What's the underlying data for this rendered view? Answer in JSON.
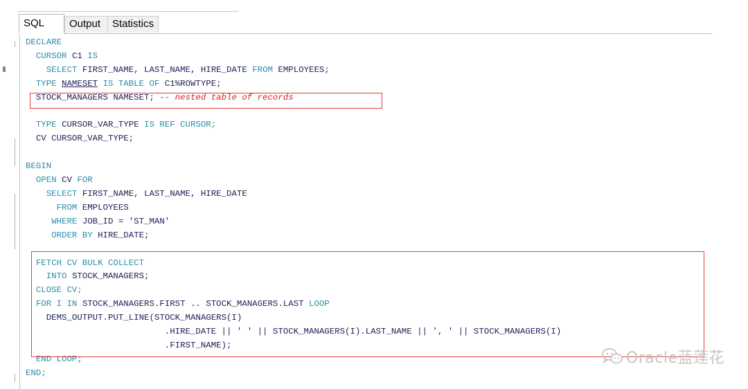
{
  "tabs": [
    {
      "label": "SQL",
      "active": true
    },
    {
      "label": "Output",
      "active": false
    },
    {
      "label": "Statistics",
      "active": false
    }
  ],
  "code": {
    "l1_declare": "DECLARE",
    "l2_cursor": "CURSOR",
    "l2_c1": "C1",
    "l2_is": "IS",
    "l3_select": "SELECT",
    "l3_cols": "FIRST_NAME, LAST_NAME, HIRE_DATE",
    "l3_from": "FROM",
    "l3_table": "EMPLOYEES;",
    "l4_type": "TYPE",
    "l4_nameset": "NAMESET",
    "l4_rest": "IS TABLE OF",
    "l4_c1": "C1%ROWTYPE;",
    "l5_decl": "STOCK_MANAGERS NAMESET;",
    "l5_comment": "-- nested table of records",
    "l7_type": "TYPE",
    "l7_name": "CURSOR_VAR_TYPE",
    "l7_rest": "IS REF CURSOR;",
    "l8_decl": "CV CURSOR_VAR_TYPE;",
    "l10_begin": "BEGIN",
    "l11_open": "OPEN",
    "l11_cv": "CV",
    "l11_for": "FOR",
    "l12_select": "SELECT",
    "l12_cols": "FIRST_NAME, LAST_NAME, HIRE_DATE",
    "l13_from": "FROM",
    "l13_table": "EMPLOYEES",
    "l14_where": "WHERE",
    "l14_cond": "JOB_ID = 'ST_MAN'",
    "l15_order": "ORDER BY",
    "l15_col": "HIRE_DATE;",
    "l17_fetch": "FETCH CV BULK COLLECT",
    "l18_into": "INTO",
    "l18_target": "STOCK_MANAGERS;",
    "l19_close": "CLOSE CV;",
    "l20_for": "FOR I IN",
    "l20_range": "STOCK_MANAGERS.FIRST .. STOCK_MANAGERS.LAST",
    "l20_loop": "LOOP",
    "l21_put": "DEMS_OUTPUT.PUT_LINE(STOCK_MANAGERS(I)",
    "l22_cont": ".HIRE_DATE || ' ' || STOCK_MANAGERS(I).LAST_NAME || ', ' || STOCK_MANAGERS(I)",
    "l23_cont": ".FIRST_NAME);",
    "l24_end": "END LOOP;",
    "l25_end": "END;"
  },
  "watermark": {
    "text": "Oracle蓝莲花",
    "icon": "wechat-icon"
  },
  "colors": {
    "keyword": "#2a8ca8",
    "identifier": "#20205a",
    "comment": "#d42020",
    "highlight_box": "#e33c3c"
  }
}
